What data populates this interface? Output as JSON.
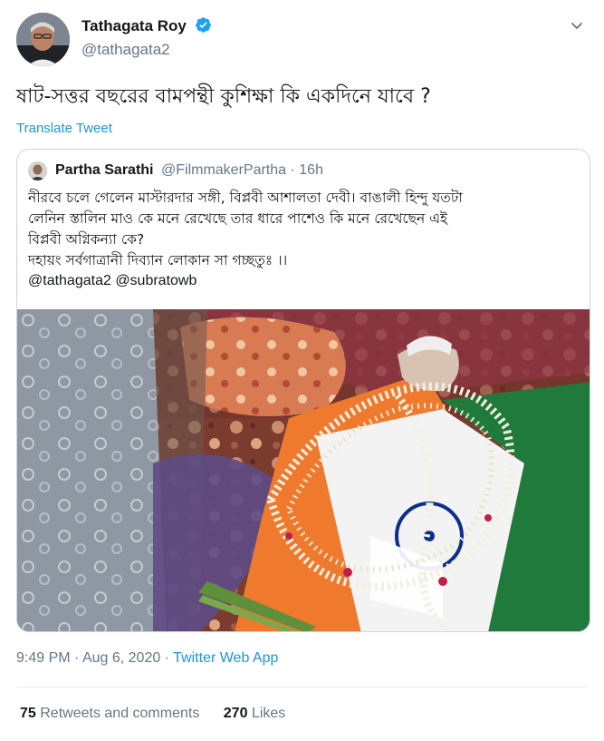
{
  "author": {
    "display_name": "Tathagata Roy",
    "handle": "@tathagata2",
    "verified": true
  },
  "tweet": {
    "text": "ষাট-সত্তর বছরের বামপন্থী কুশিক্ষা কি একদিনে যাবে ?",
    "translate_label": "Translate Tweet"
  },
  "quoted_tweet": {
    "display_name": "Partha Sarathi",
    "handle_time": "@FilmmakerPartha · 16h",
    "text_lines": [
      "নীরবে চলে গেলেন মাস্টারদার সঙ্গী, বিপ্লবী আশালতা দেবী। বাঙালী হিন্দু যতটা",
      "লেনিন স্তালিন মাও কে মনে রেখেছে তার ধারে পাশেও কি মনে রেখেছেন এই",
      "বিপ্লবী অগ্নিকন্যা কে?",
      "দহায়ং সর্বগাত্রানী দিব্যান লোকান সা গচ্ছতুঃ ।।"
    ],
    "mentions": "@tathagata2 @subratowb"
  },
  "meta": {
    "time": "9:49 PM",
    "date": "Aug 6, 2020",
    "separator": " · ",
    "source": "Twitter Web App"
  },
  "stats": {
    "retweets_count": "75",
    "retweets_label": "Retweets and comments",
    "likes_count": "270",
    "likes_label": "Likes"
  },
  "colors": {
    "link": "#1b95e0",
    "secondary_text": "#657786",
    "border": "#ccd6dd"
  }
}
